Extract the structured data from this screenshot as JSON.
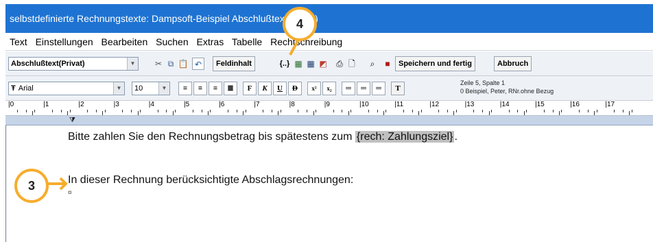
{
  "window": {
    "title": "selbstdefinierte Rechnungstexte: Dampsoft-Beispiel Abschlußtext(Privat)"
  },
  "menu": [
    "Text",
    "Einstellungen",
    "Bearbeiten",
    "Suchen",
    "Extras",
    "Tabelle",
    "Rechtschreibung"
  ],
  "toolbar1": {
    "template_value": "Abschlußtext(Privat)",
    "feldinhalt_label": "Feldinhalt",
    "speichern_label": "Speichern und fertig",
    "abbruch_label": "Abbruch"
  },
  "toolbar2": {
    "font_value": "Arial",
    "size_value": "10",
    "bold_label": "F",
    "italic_label": "K",
    "underline_label": "U",
    "strike_label": "D",
    "superscript_label": "x²",
    "subscript_label": "x₂",
    "cursor_position": "Zeile 5, Spalte 1",
    "context_info": "0 Beispiel, Peter, RNr.ohne Bezug"
  },
  "ruler": {
    "labels": [
      "0",
      "1",
      "2",
      "3",
      "4",
      "5",
      "6",
      "7",
      "8",
      "9",
      "10",
      "11",
      "12",
      "13",
      "14",
      "15",
      "16",
      "17"
    ]
  },
  "document": {
    "line1_prefix": "Bitte zahlen Sie den Rechnungsbetrag bis spätestens zum ",
    "line1_field": "{rech: Zahlungsziel}",
    "line1_suffix": ".",
    "line2": "In dieser Rechnung berücksichtigte Abschlagsrechnungen:",
    "paragraph_mark": "¤"
  },
  "annotations": {
    "badge_3": "3",
    "badge_4": "4",
    "color": "#f6ad2e"
  },
  "colors": {
    "titlebar": "#1e73d2",
    "field_highlight": "#c0c0c0"
  }
}
